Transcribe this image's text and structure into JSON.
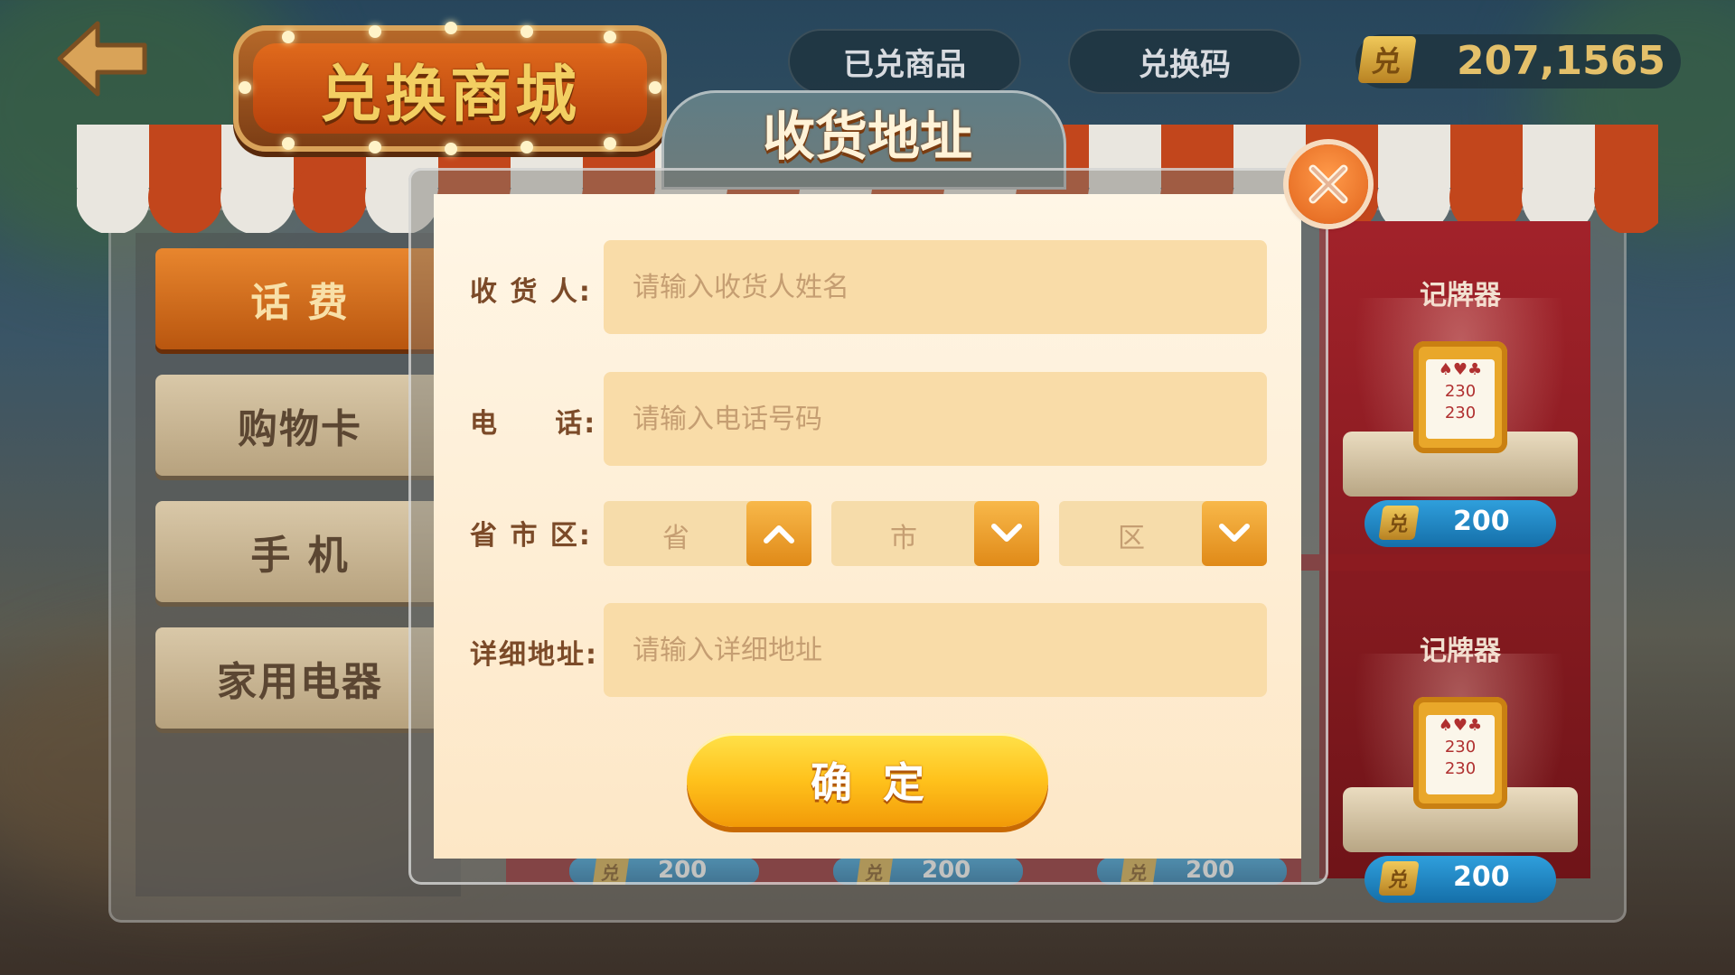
{
  "header": {
    "back_icon": "back-arrow-icon",
    "title": "兑换商城",
    "tabs": [
      {
        "label": "已兑商品"
      },
      {
        "label": "兑换码"
      }
    ],
    "coins": {
      "icon_label": "兑",
      "value": "207,1565"
    }
  },
  "sidebar": {
    "items": [
      {
        "label": "话 费",
        "active": true
      },
      {
        "label": "购物卡",
        "active": false
      },
      {
        "label": "手 机",
        "active": false
      },
      {
        "label": "家用电器",
        "active": false
      }
    ]
  },
  "products": [
    {
      "name": "记牌器",
      "coin_label": "兑",
      "price": "200",
      "paper": "♠♥♣\n230\n230"
    },
    {
      "name": "记牌器",
      "coin_label": "兑",
      "price": "200",
      "paper": "♠♥♣\n230\n230"
    }
  ],
  "hidden_prices": [
    {
      "coin_label": "兑",
      "price": "200"
    },
    {
      "coin_label": "兑",
      "price": "200"
    },
    {
      "coin_label": "兑",
      "price": "200"
    }
  ],
  "dialog": {
    "title": "收货地址",
    "close_icon": "close-x-icon",
    "fields": {
      "name_label": "收 货 人:",
      "name_placeholder": "请输入收货人姓名",
      "phone_label": "电     话:",
      "phone_placeholder": "请输入电话号码",
      "region_label": "省 市 区:",
      "province": "省",
      "city": "市",
      "district": "区",
      "detail_label": "详细地址:",
      "detail_placeholder": "请输入详细地址"
    },
    "confirm_label": "确定",
    "colors": {
      "accent": "#f29a08",
      "input_bg": "#f9dca8",
      "label": "#7b4a28"
    }
  }
}
